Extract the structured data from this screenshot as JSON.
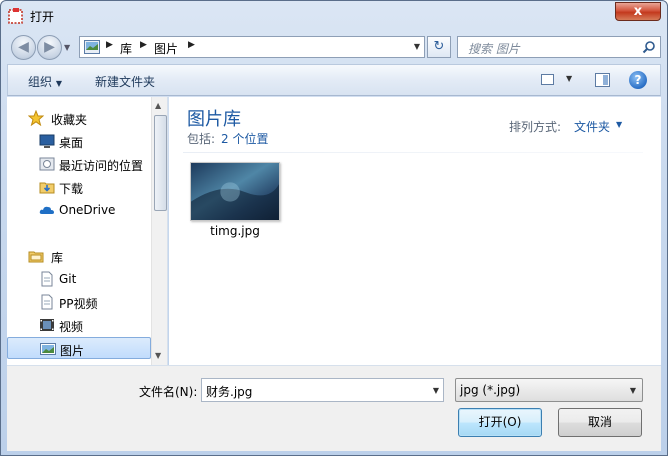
{
  "window": {
    "title": "打开",
    "close_symbol": "x"
  },
  "navigation": {
    "breadcrumb": [
      "库",
      "图片"
    ],
    "search_placeholder": "搜索 图片"
  },
  "toolbar": {
    "organize_label": "组织",
    "new_folder_label": "新建文件夹",
    "help_symbol": "?"
  },
  "sidebar": {
    "items": [
      {
        "label": "收藏夹",
        "icon": "star-icon"
      },
      {
        "label": "桌面",
        "icon": "desktop-icon"
      },
      {
        "label": "最近访问的位置",
        "icon": "recent-places-icon"
      },
      {
        "label": "下载",
        "icon": "download-folder-icon"
      },
      {
        "label": "OneDrive",
        "icon": "onedrive-cloud-icon"
      },
      {
        "label": "库",
        "icon": "library-icon"
      },
      {
        "label": "Git",
        "icon": "document-icon"
      },
      {
        "label": "PP视频",
        "icon": "document-icon"
      },
      {
        "label": "视频",
        "icon": "video-icon"
      },
      {
        "label": "图片",
        "icon": "picture-icon",
        "selected": true
      }
    ]
  },
  "content": {
    "library_title": "图片库",
    "includes_label": "包括:",
    "includes_link": "2 个位置",
    "arrange_label": "排列方式:",
    "arrange_value": "文件夹",
    "files": [
      {
        "name": "timg.jpg"
      }
    ]
  },
  "bottom": {
    "filename_label": "文件名(N):",
    "filename_value": "财务.jpg",
    "filetype_value": "jpg (*.jpg)",
    "open_label": "打开(O)",
    "cancel_label": "取消"
  }
}
